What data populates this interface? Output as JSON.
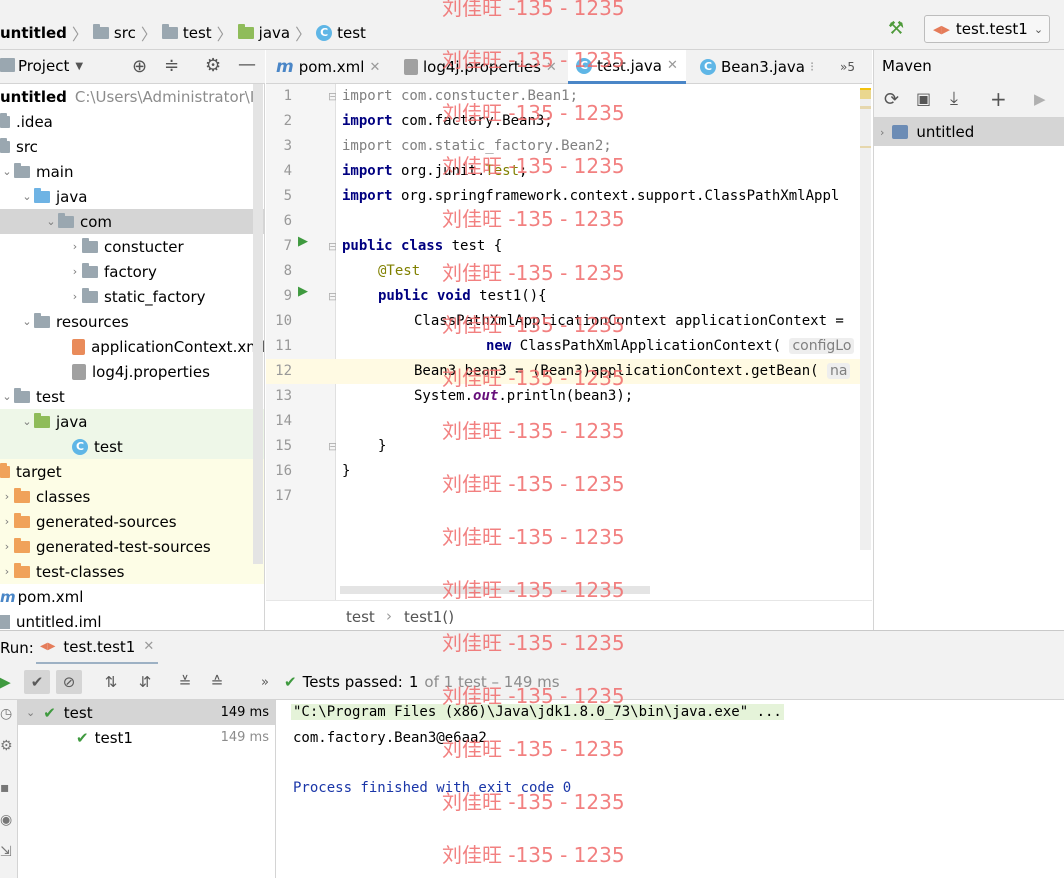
{
  "navbar": {
    "crumbs": [
      "untitled",
      "src",
      "test",
      "java",
      "test"
    ],
    "run_config": "test.test1"
  },
  "project_panel": {
    "title": "Project",
    "tree": [
      {
        "label": "untitled",
        "path": "C:\\Users\\Administrator\\IdeaProjects\\untitled",
        "icon": "folder-icon"
      },
      {
        "label": ".idea",
        "icon": "folder-icon"
      },
      {
        "label": "src",
        "icon": "folder-icon"
      },
      {
        "label": "main",
        "icon": "folder-icon"
      },
      {
        "label": "java",
        "icon": "source-folder-icon"
      },
      {
        "label": "com",
        "icon": "package-icon"
      },
      {
        "label": "constucter",
        "icon": "package-icon"
      },
      {
        "label": "factory",
        "icon": "package-icon"
      },
      {
        "label": "static_factory",
        "icon": "package-icon"
      },
      {
        "label": "resources",
        "icon": "resources-folder-icon"
      },
      {
        "label": "applicationContext.xml",
        "icon": "xml-file-icon"
      },
      {
        "label": "log4j.properties",
        "icon": "properties-file-icon"
      },
      {
        "label": "test",
        "icon": "folder-icon"
      },
      {
        "label": "java",
        "icon": "test-source-folder-icon"
      },
      {
        "label": "test",
        "icon": "class-icon"
      },
      {
        "label": "target",
        "icon": "excluded-folder-icon"
      },
      {
        "label": "classes",
        "icon": "excluded-folder-icon"
      },
      {
        "label": "generated-sources",
        "icon": "excluded-folder-icon"
      },
      {
        "label": "generated-test-sources",
        "icon": "excluded-folder-icon"
      },
      {
        "label": "test-classes",
        "icon": "excluded-folder-icon"
      },
      {
        "label": "pom.xml",
        "icon": "maven-file-icon"
      },
      {
        "label": "untitled.iml",
        "icon": "module-file-icon"
      }
    ]
  },
  "editor": {
    "tabs": [
      {
        "label": "pom.xml",
        "icon": "maven-file-icon"
      },
      {
        "label": "log4j.properties",
        "icon": "properties-file-icon"
      },
      {
        "label": "test.java",
        "icon": "class-icon",
        "active": true
      },
      {
        "label": "Bean3.java",
        "icon": "class-icon"
      }
    ],
    "overflow_label": "»5",
    "line_numbers": [
      "1",
      "2",
      "3",
      "4",
      "5",
      "6",
      "7",
      "8",
      "9",
      "10",
      "11",
      "12",
      "13",
      "14",
      "15",
      "16",
      "17"
    ],
    "code": {
      "l1_kw": "import",
      "l1_rest": " com.constucter.Bean1;",
      "l2_kw": "import",
      "l2_rest": " com.factory.Bean3;",
      "l3_kw": "import",
      "l3_rest": " com.static_factory.Bean2;",
      "l4_kw": "import",
      "l4_rest": " org.junit.",
      "l4_test": "Test",
      "l4_end": ";",
      "l5_kw": "import",
      "l5_rest": " org.springframework.context.support.ClassPathXmlAppl",
      "l7_kw": "public class",
      "l7_rest": " test {",
      "l8_ann": "@Test",
      "l9_kw": "public void",
      "l9_rest": " test1(){",
      "l10": "ClassPathXmlApplicationContext applicationContext =",
      "l11_kw": "new",
      "l11_rest": " ClassPathXmlApplicationContext(",
      "l11_hint": "configLo",
      "l12": "Bean3 bean3 = (Bean3)applicationContext.getBean(",
      "l12_hint": "na",
      "l13_a": "System.",
      "l13_out": "out",
      "l13_b": ".println(bean3);",
      "l15": "}",
      "l16": "}"
    },
    "breadcrumb": [
      "test",
      "test1()"
    ]
  },
  "maven": {
    "title": "Maven",
    "project": "untitled"
  },
  "run": {
    "label": "Run:",
    "tab": "test.test1",
    "status_prefix": "Tests passed:",
    "status_count": "1",
    "status_suffix": "of 1 test – 149 ms",
    "tree": [
      {
        "label": "test",
        "time": "149 ms"
      },
      {
        "label": "test1",
        "time": "149 ms"
      }
    ],
    "console": [
      "\"C:\\Program Files (x86)\\Java\\jdk1.8.0_73\\bin\\java.exe\" ...",
      "com.factory.Bean3@e6aa2",
      "",
      "Process finished with exit code 0"
    ]
  },
  "watermark": "刘佳旺 -135 - 1235",
  "colors": {
    "accent_green": "#3f9a3f",
    "selection": "#d5d5d5",
    "watermark": "#f06a6a",
    "keyword": "#000080"
  }
}
